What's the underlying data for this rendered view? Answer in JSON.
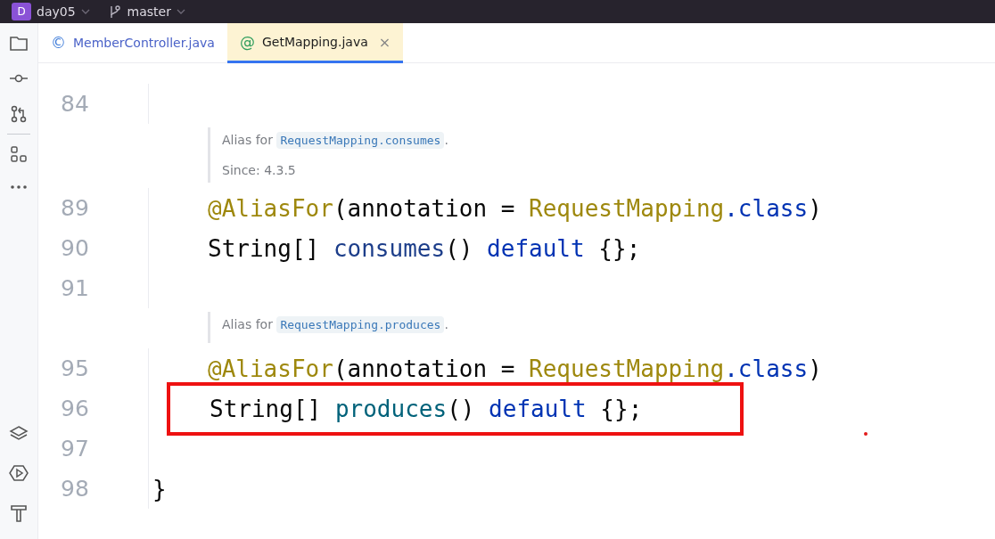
{
  "title_bar": {
    "project_badge": "D",
    "project": "day05",
    "branch": "master"
  },
  "tabs": [
    {
      "label": "MemberController.java",
      "icon": "©",
      "kind": "class",
      "selected": false
    },
    {
      "label": "GetMapping.java",
      "icon": "@",
      "kind": "annotation",
      "selected": true,
      "close": "×"
    }
  ],
  "editor": {
    "blocks": [
      {
        "kind": "code",
        "number": "84"
      },
      {
        "kind": "doc",
        "lead": "Alias for",
        "link": "RequestMapping.consumes",
        "tail": ".",
        "since": "Since: 4.3.5"
      },
      {
        "kind": "code",
        "number": "89",
        "indented": true,
        "tokens": [
          {
            "text": "@AliasFor",
            "kind": "annotation"
          },
          {
            "text": "(annotation = ",
            "kind": "plain"
          },
          {
            "text": "RequestMapping",
            "kind": "annotation"
          },
          {
            "text": ".class",
            "kind": "keyword"
          },
          {
            "text": ")",
            "kind": "plain"
          }
        ]
      },
      {
        "kind": "code",
        "number": "90",
        "indented": true,
        "tokens": [
          {
            "text": "String[] ",
            "kind": "plain"
          },
          {
            "text": "consumes",
            "kind": "field"
          },
          {
            "text": "() ",
            "kind": "plain"
          },
          {
            "text": "default",
            "kind": "keyword"
          },
          {
            "text": " {};",
            "kind": "plain"
          }
        ]
      },
      {
        "kind": "code",
        "number": "91"
      },
      {
        "kind": "doc",
        "lead": "Alias for",
        "link": "RequestMapping.produces",
        "tail": "."
      },
      {
        "kind": "code",
        "number": "95",
        "indented": true,
        "tokens": [
          {
            "text": "@AliasFor",
            "kind": "annotation"
          },
          {
            "text": "(annotation = ",
            "kind": "plain"
          },
          {
            "text": "RequestMapping",
            "kind": "annotation"
          },
          {
            "text": ".class",
            "kind": "keyword"
          },
          {
            "text": ")",
            "kind": "plain"
          }
        ]
      },
      {
        "kind": "code",
        "number": "96",
        "indented": true,
        "highlighted": true,
        "tokens": [
          {
            "text": "String[] ",
            "kind": "plain"
          },
          {
            "text": "produces",
            "kind": "method"
          },
          {
            "text": "() ",
            "kind": "plain"
          },
          {
            "text": "default",
            "kind": "keyword"
          },
          {
            "text": " {};",
            "kind": "plain"
          }
        ]
      },
      {
        "kind": "code",
        "number": "97"
      },
      {
        "kind": "code",
        "number": "98",
        "indented": false,
        "tokens": [
          {
            "text": "}",
            "kind": "plain"
          }
        ]
      }
    ]
  }
}
